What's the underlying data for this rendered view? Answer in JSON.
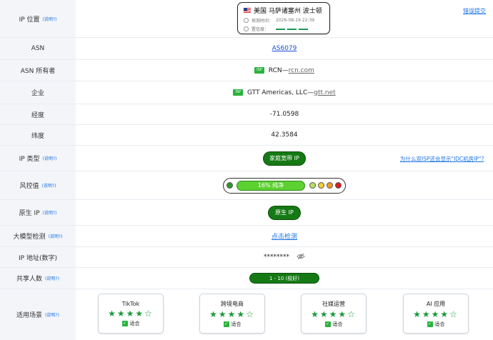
{
  "rows": {
    "location": {
      "label": "IP 位置",
      "help": "(说明?)",
      "flag": "us-flag-icon",
      "city": "美国 马萨诸塞州 波士顿",
      "time_label": "探测时间：",
      "time_value": "2026-08-19 22:39",
      "confidence_label": "置信度：",
      "confidence_level": 3,
      "report_link": "错误提交"
    },
    "asn": {
      "label": "ASN",
      "value": "AS6079"
    },
    "asn_owner": {
      "label": "ASN 所有者",
      "tag": "ISP",
      "name": "RCN— ",
      "domain": "rcn.com"
    },
    "company": {
      "label": "企业",
      "tag": "ISP",
      "name": "GTT Americas, LLC— ",
      "domain": "gtt.net"
    },
    "longitude": {
      "label": "经度",
      "value": "-71.0598"
    },
    "latitude": {
      "label": "纬度",
      "value": "42.3584"
    },
    "ip_type": {
      "label": "IP 类型",
      "help": "(说明?)",
      "value": "家庭宽带 IP",
      "side_link": "为什么双ISP还会显示\"IDC机房IP\"?"
    },
    "risk": {
      "label": "风控值",
      "help": "(说明?)",
      "percent": 16,
      "text": "16%  纯净",
      "dot_colors": [
        "#2a9a2a",
        "#b9e05a",
        "#f2d02e",
        "#f29a22",
        "#d91e1e"
      ]
    },
    "native_ip": {
      "label": "原生 IP",
      "help": "(说明?)",
      "value": "原生 IP"
    },
    "llm_check": {
      "label": "大模型检测",
      "help": "(说明?)",
      "value": "点击检测"
    },
    "ip_number": {
      "label": "IP 地址(数字)",
      "value": "********",
      "icon": "eye-off-icon"
    },
    "shared": {
      "label": "共享人数",
      "help": "(说明?)",
      "value": "1 - 10 (极好)"
    },
    "scenarios": {
      "label": "适用场景",
      "help": "(说明?)",
      "ok_label": "适合",
      "items": [
        {
          "name": "TikTok",
          "stars": "★★★★☆"
        },
        {
          "name": "跨境电商",
          "stars": "★★★★☆"
        },
        {
          "name": "社媒运营",
          "stars": "★★★★☆"
        },
        {
          "name": "AI 应用",
          "stars": "★★★★☆"
        }
      ]
    }
  }
}
